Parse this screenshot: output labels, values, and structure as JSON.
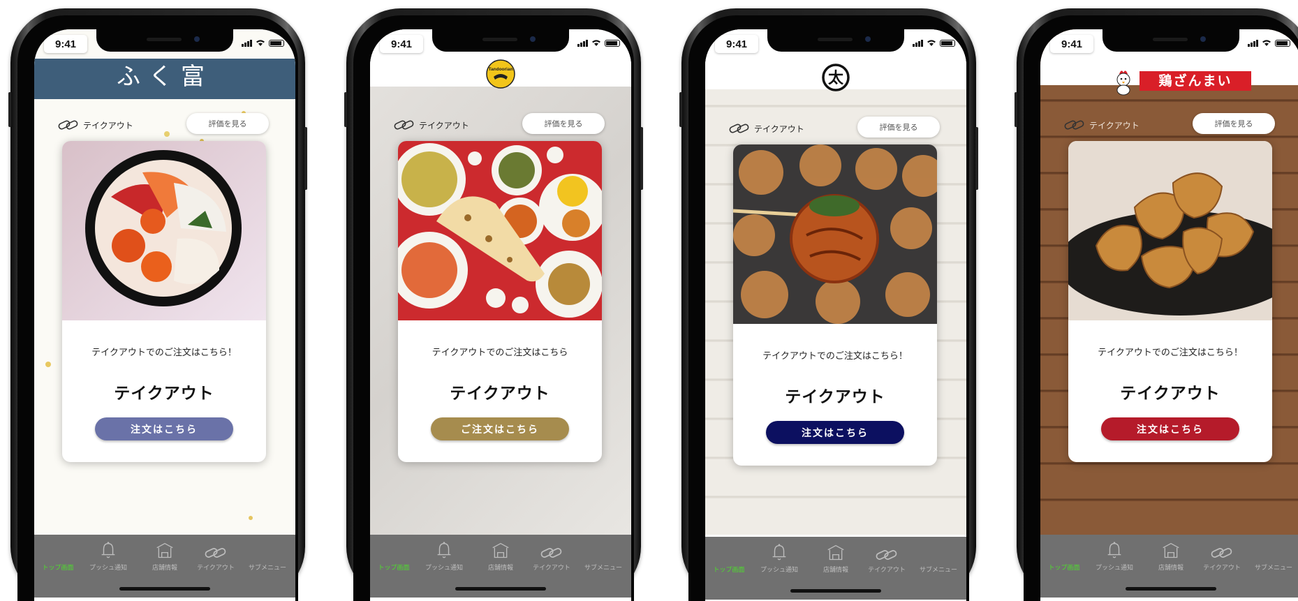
{
  "status_time": "9:41",
  "phones": [
    {
      "brand": "ふく富",
      "takeout_label": "テイクアウト",
      "review_label": "評価を見る",
      "card_subtitle": "テイクアウトでのご注文はこちら！",
      "card_title": "テイクアウト",
      "order_label": "注文はこちら",
      "accent": "#6a72a8",
      "tabs": [
        "トップ画面",
        "プッシュ通知",
        "店舗情報",
        "テイクアウト",
        "サブメニュー"
      ]
    },
    {
      "brand": "Tandoorian",
      "takeout_label": "テイクアウト",
      "review_label": "評価を見る",
      "card_subtitle": "テイクアウトでのご注文はこちら",
      "card_title": "テイクアウト",
      "order_label": "ご注文はこちら",
      "accent": "#a68c4e",
      "tabs": [
        "トップ画面",
        "プッシュ通知",
        "店舗情報",
        "テイクアウト",
        "サブメニュー"
      ]
    },
    {
      "brand": "太",
      "takeout_label": "テイクアウト",
      "review_label": "評価を見る",
      "card_subtitle": "テイクアウトでのご注文はこちら！",
      "card_title": "テイクアウト",
      "order_label": "注文はこちら",
      "accent": "#0c1060",
      "tabs": [
        "トップ画面",
        "プッシュ通知",
        "店舗情報",
        "テイクアウト",
        "サブメニュー"
      ]
    },
    {
      "brand": "鶏ざんまい",
      "takeout_label": "テイクアウト",
      "review_label": "評価を見る",
      "card_subtitle": "テイクアウトでのご注文はこちら！",
      "card_title": "テイクアウト",
      "order_label": "注文はこちら",
      "accent": "#b51b2a",
      "tabs": [
        "トップ画面",
        "プッシュ通知",
        "店舗情報",
        "テイクアウト",
        "サブメニュー"
      ]
    }
  ]
}
